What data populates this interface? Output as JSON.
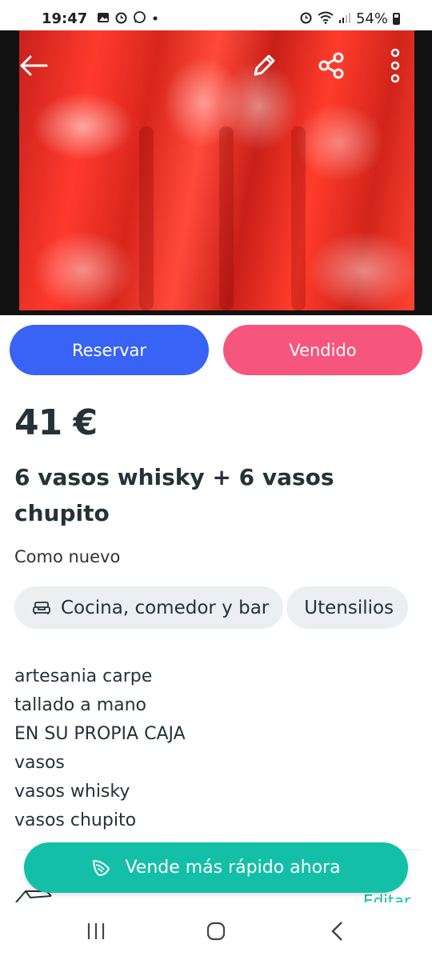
{
  "status_bar": {
    "time": "19:47",
    "battery": "54%",
    "left_icons": [
      "gallery-icon",
      "alarm-icon",
      "whatsapp-icon",
      "dot-icon"
    ],
    "right_icons": [
      "alarm-icon",
      "wifi-icon",
      "signal-icon",
      "battery-icon"
    ]
  },
  "gallery": {
    "image_alt": "Red satin box with crystal glasses",
    "page_indicator": {
      "count": 2,
      "active": 1
    }
  },
  "toolbar": {
    "back_icon": "arrow-left-icon",
    "edit_icon": "pencil-icon",
    "share_icon": "share-icon",
    "more_icon": "more-vertical-icon"
  },
  "actions": {
    "reserve_label": "Reservar",
    "sold_label": "Vendido"
  },
  "listing": {
    "price": "41 €",
    "title": "6 vasos whisky + 6 vasos chupito",
    "condition": "Como nuevo",
    "categories": [
      {
        "label": "Cocina, comedor y bar",
        "icon": "sofa-icon"
      },
      {
        "label": "Utensilios",
        "icon": ""
      }
    ],
    "description_lines": [
      "artesania carpe",
      "tallado a mano",
      "EN SU PROPIA CAJA",
      "vasos",
      "vasos whisky",
      "vasos chupito"
    ]
  },
  "promo": {
    "label": "Vende más rápido ahora",
    "icon": "wing-icon"
  },
  "below": {
    "edit_link": "Editar"
  },
  "colors": {
    "reserve": "#3863f4",
    "sold": "#f6557e",
    "promo": "#14bfa8",
    "text": "#253238",
    "chip_bg": "#eceff1"
  },
  "nav": {
    "recents_icon": "recents-icon",
    "home_icon": "home-icon",
    "back_icon": "back-chevron-icon"
  }
}
